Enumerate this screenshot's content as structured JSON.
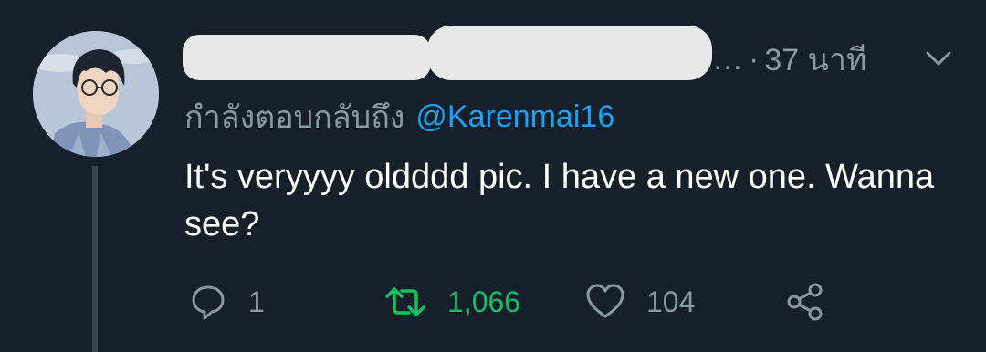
{
  "tweet": {
    "timestamp_prefix": "…",
    "separator": "·",
    "timestamp": "37 นาที",
    "reply_prefix": "กำลังตอบกลับถึง",
    "reply_handle": "@Karenmai16",
    "text": "It's veryyyy oldddd pic. I have a new one. Wanna see?"
  },
  "actions": {
    "reply_count": "1",
    "retweet_count": "1,066",
    "like_count": "104"
  },
  "colors": {
    "background": "#15202b",
    "muted": "#8899a6",
    "link": "#1da1f2",
    "retweet": "#17bf63"
  },
  "icons": [
    "avatar",
    "chevron-down-icon",
    "reply-icon",
    "retweet-icon",
    "like-icon",
    "share-icon"
  ]
}
